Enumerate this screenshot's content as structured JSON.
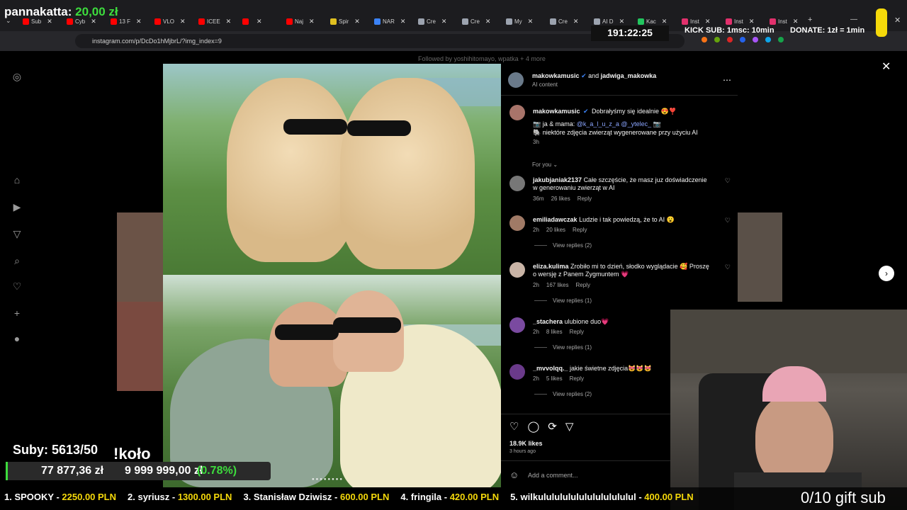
{
  "browser": {
    "tabs": [
      {
        "label": "Sub",
        "color": "#ff0000"
      },
      {
        "label": "Cyb",
        "color": "#ff0000"
      },
      {
        "label": "13 F",
        "color": "#ff0000"
      },
      {
        "label": "VLO",
        "color": "#ff0000"
      },
      {
        "label": "ICEE",
        "color": "#ff0000"
      },
      {
        "label": "",
        "color": "#ff0000"
      },
      {
        "label": "Naj",
        "color": "#ff0000"
      },
      {
        "label": "Spir",
        "color": "#e0c020"
      },
      {
        "label": "NAR",
        "color": "#3b82f6"
      },
      {
        "label": "Cre",
        "color": "#9ca3af"
      },
      {
        "label": "Cre",
        "color": "#9ca3af"
      },
      {
        "label": "My",
        "color": "#9ca3af"
      },
      {
        "label": "Cre",
        "color": "#9ca3af"
      },
      {
        "label": "AI D",
        "color": "#9ca3af"
      },
      {
        "label": "Kac",
        "color": "#22c55e"
      },
      {
        "label": "Inst",
        "color": "#e1306c"
      },
      {
        "label": "Inst",
        "color": "#e1306c"
      },
      {
        "label": "Inst",
        "color": "#e1306c"
      }
    ],
    "url": "instagram.com/p/DcDo1hMjbrL/?img_index=9"
  },
  "stream": {
    "top_left_name": "pannakatta:",
    "top_left_amount": "20,00 zł",
    "timer": "191:22:25",
    "kick_sub": "KICK SUB: 1msc: 10min",
    "donate": "DONATE: 1zł = 1min",
    "suby": "Suby: 5613/50",
    "kolo": "!koło",
    "money": "77 877,36 zł",
    "goal": "9 999 999,00 zł",
    "goal_pct": "(0.78%)",
    "gift_sub": "0/10 gift sub",
    "leaderboard": [
      {
        "rank": "1. SPOOKY - ",
        "amount": "2250.00 PLN"
      },
      {
        "rank": "2. syriusz - ",
        "amount": "1300.00 PLN"
      },
      {
        "rank": "3. Stanisław Dziwisz - ",
        "amount": "600.00 PLN"
      },
      {
        "rank": "4. fringila - ",
        "amount": "420.00 PLN"
      },
      {
        "rank": "5. wilkulululululululululululul - ",
        "amount": "400.00 PLN"
      }
    ]
  },
  "post": {
    "followed_by": "Followed by yoshihitomayo, wpatka + 4 more",
    "author": "makowkamusic",
    "and": "and",
    "coauthor": "jadwiga_makowka",
    "ai_label": "AI content",
    "caption_user": "makowkamusic",
    "caption_line1": "Dobrałyśmy się idealnie 😍❣️",
    "caption_line2": "📷 ja & mama:",
    "caption_mentions": "@k_a_l_u_z_a @_ytelec_",
    "caption_line2_end": "📷",
    "caption_line3": "🐘 niektóre zdjęcia zwierząt wygenerowane przy użyciu AI",
    "caption_time": "3h",
    "for_you": "For you",
    "likes": "18.9K likes",
    "posted": "3 hours ago",
    "add_comment": "Add a comment..."
  },
  "comments": [
    {
      "user": "jakubjaniak2137",
      "text": "Całe szczęście, że masz juz doświadczenie w generowaniu zwierząt w AI",
      "time": "36m",
      "likes": "26 likes",
      "reply": "Reply",
      "view": ""
    },
    {
      "user": "emiliadawczak",
      "text": "Ludzie i tak powiedzą, że to AI 😮",
      "time": "2h",
      "likes": "20 likes",
      "reply": "Reply",
      "view": "View replies (2)"
    },
    {
      "user": "eliza.kulima",
      "text": "Zrobiło mi to dzień, słodko wyglądacie 🥰 Proszę o wersję z Panem Zygmuntem 💗",
      "time": "2h",
      "likes": "167 likes",
      "reply": "Reply",
      "view": "View replies (1)"
    },
    {
      "user": "_stachera",
      "text": "ulubione duo💗",
      "time": "2h",
      "likes": "8 likes",
      "reply": "Reply",
      "view": "View replies (1)"
    },
    {
      "user": "_mvvolqq._",
      "text": "jakie świetne zdjęcia😻😻😻",
      "time": "2h",
      "likes": "5 likes",
      "reply": "Reply",
      "view": "View replies (2)"
    }
  ],
  "colors": {
    "accent_green": "#3ddc3d",
    "accent_yellow": "#f5d90a",
    "ig_link": "#8aa5ff"
  },
  "icons": [
    "instagram-icon",
    "home-icon",
    "reels-icon",
    "messages-icon",
    "search-icon",
    "heart-icon",
    "create-icon",
    "profile-icon",
    "close-icon",
    "next-arrow-icon",
    "prev-arrow-icon",
    "like-icon",
    "comment-icon",
    "repost-icon",
    "share-icon",
    "emoji-icon",
    "more-icon",
    "verified-icon"
  ]
}
